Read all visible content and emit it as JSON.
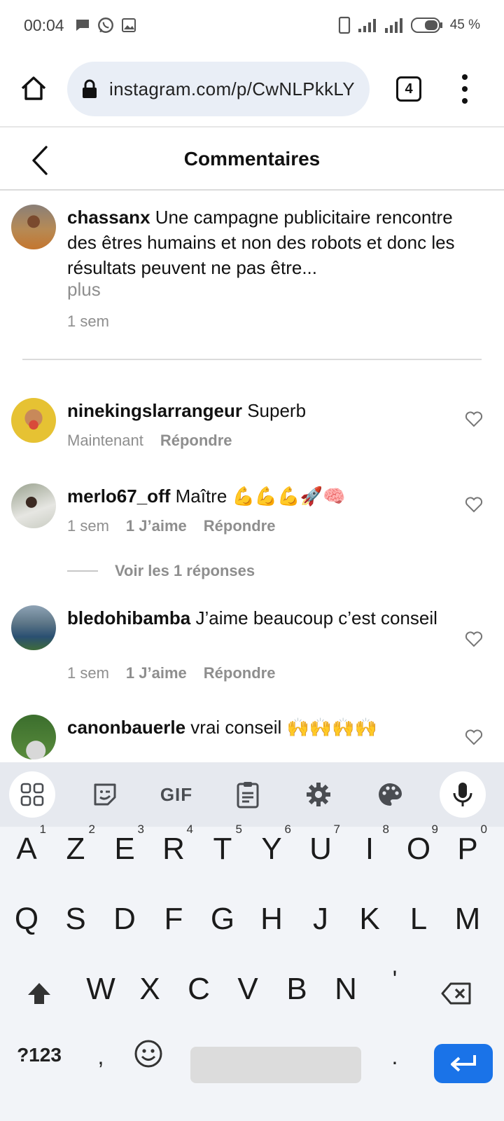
{
  "status_bar": {
    "time": "00:04",
    "battery": "45 %"
  },
  "browser": {
    "url": "instagram.com/p/CwNLPkkLY",
    "tab_count": "4"
  },
  "header": {
    "title": "Commentaires"
  },
  "caption": {
    "username": "chassanx",
    "text": " Une campagne publicitaire rencontre des êtres humains et non des robots et donc les résultats peuvent ne pas être...",
    "more": "plus",
    "time": "1 sem"
  },
  "comments": [
    {
      "username": "ninekingslarrangeur",
      "text": " Superb",
      "time": "Maintenant",
      "likes": "",
      "reply": "Répondre"
    },
    {
      "username": "merlo67_off",
      "text": " Maître 💪💪💪🚀🧠",
      "time": "1 sem",
      "likes": "1 J’aime",
      "reply": "Répondre",
      "view_replies": "Voir les 1 réponses"
    },
    {
      "username": "bledohibamba",
      "text": " J’aime beaucoup c’est conseil",
      "time": "1 sem",
      "likes": "1 J’aime",
      "reply": "Répondre"
    },
    {
      "username": "canonbauerle",
      "text": " vrai conseil 🙌🙌🙌🙌",
      "time": "",
      "likes": "",
      "reply": ""
    }
  ],
  "keyboard": {
    "toolbar": [
      "apps-icon",
      "sticker-icon",
      "GIF",
      "clipboard-icon",
      "settings-icon",
      "palette-icon",
      "mic-icon"
    ],
    "gif_label": "GIF",
    "row1": [
      "A",
      "Z",
      "E",
      "R",
      "T",
      "Y",
      "U",
      "I",
      "O",
      "P"
    ],
    "row1_hints": [
      "1",
      "2",
      "3",
      "4",
      "5",
      "6",
      "7",
      "8",
      "9",
      "0"
    ],
    "row2": [
      "Q",
      "S",
      "D",
      "F",
      "G",
      "H",
      "J",
      "K",
      "L",
      "M"
    ],
    "row3": [
      "W",
      "X",
      "C",
      "V",
      "B",
      "N",
      "'"
    ],
    "symbols_label": "?123",
    "comma": ",",
    "period": "."
  }
}
